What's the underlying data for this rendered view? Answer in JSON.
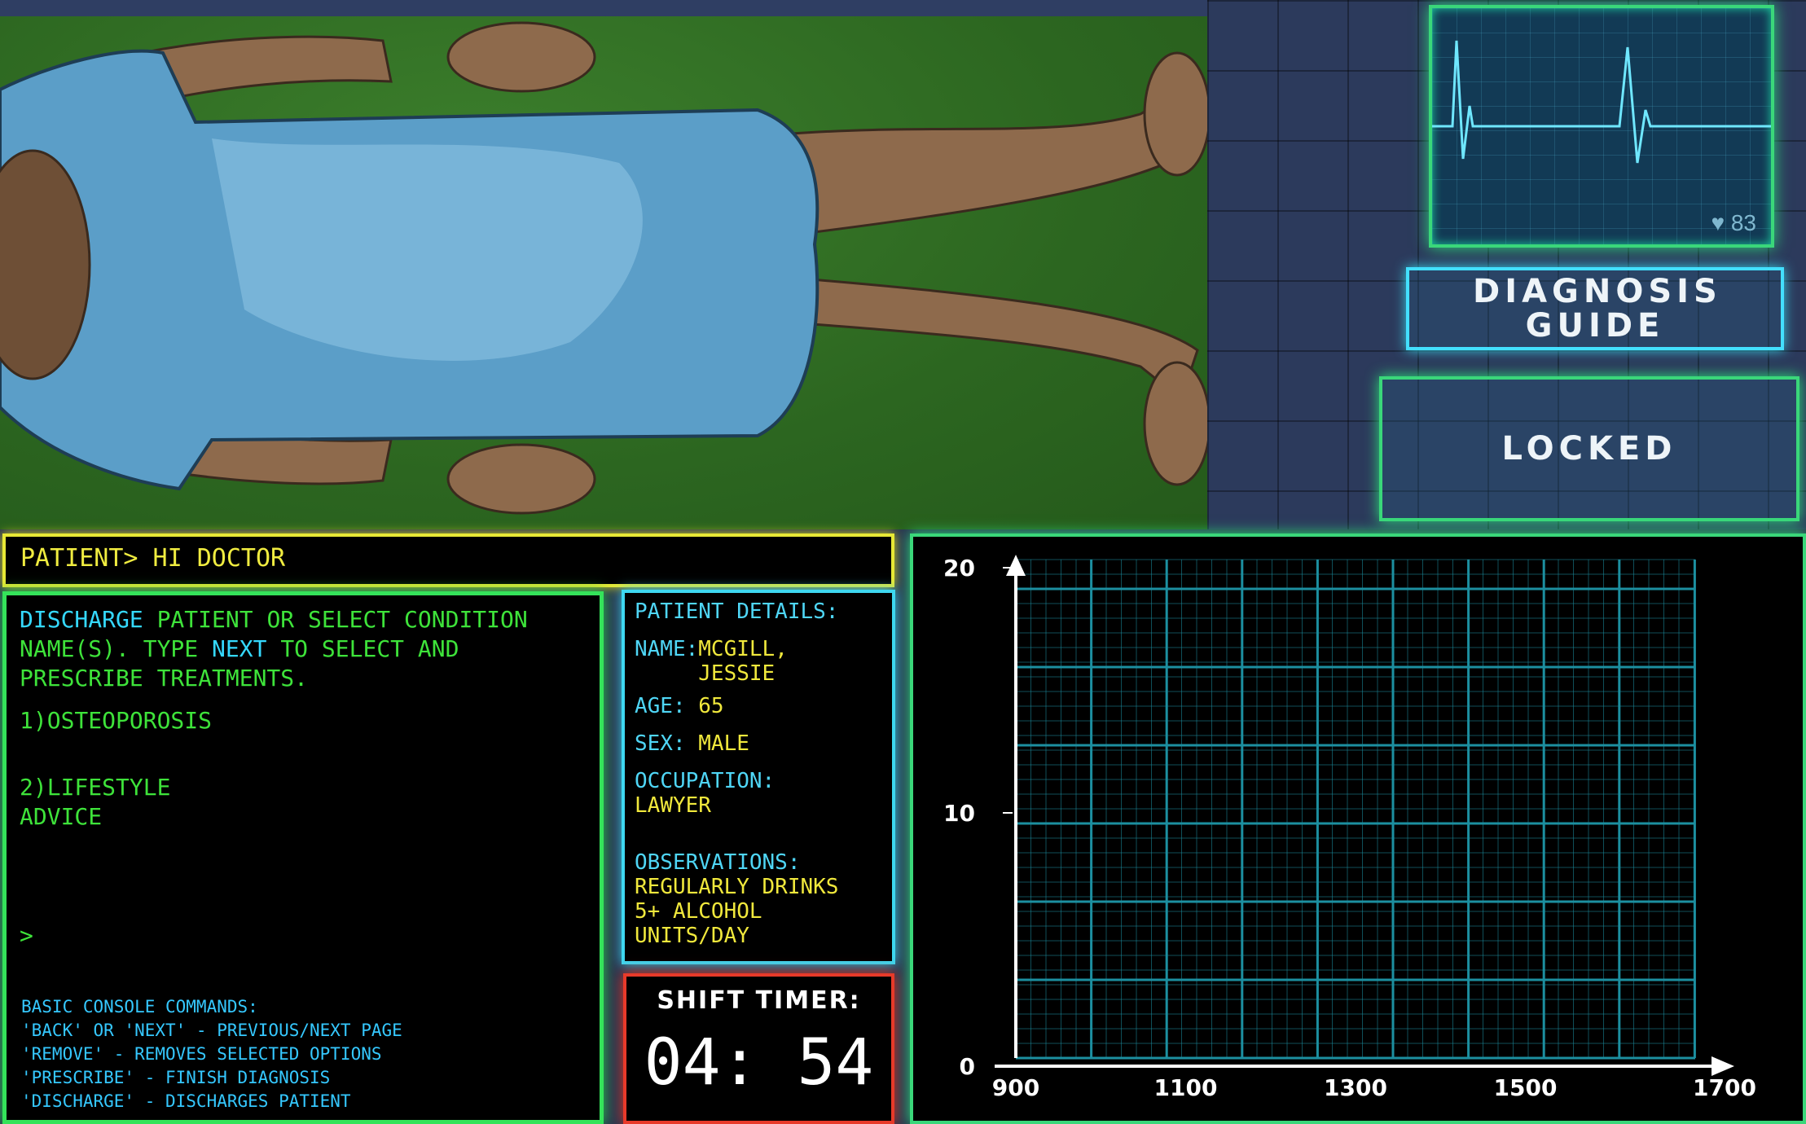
{
  "monitor": {
    "heart_rate": "83",
    "heart_icon": "heart-icon"
  },
  "buttons": {
    "diagnosis_guide": "DIAGNOSIS GUIDE",
    "locked": "LOCKED"
  },
  "dialogue": {
    "text": "PATIENT> HI DOCTOR"
  },
  "console": {
    "intro_1": "DISCHARGE",
    "intro_2": "PATIENT OR SELECT CONDITION NAME(S). TYPE",
    "intro_3": "NEXT",
    "intro_4": "TO SELECT AND PRESCRIBE TREATMENTS.",
    "options": [
      "1)OSTEOPOROSIS",
      "2)LIFESTYLE ADVICE"
    ],
    "prompt": ">",
    "commands_title": "BASIC CONSOLE COMMANDS:",
    "commands": [
      "'BACK' OR 'NEXT' - PREVIOUS/NEXT PAGE",
      "'REMOVE' - REMOVES SELECTED OPTIONS",
      "'PRESCRIBE' - FINISH DIAGNOSIS",
      "'DISCHARGE' - DISCHARGES PATIENT"
    ]
  },
  "details": {
    "title": "PATIENT DETAILS:",
    "name_label": "NAME:",
    "name_value": "MCGILL, JESSIE",
    "age_label": "AGE:",
    "age_value": "65",
    "sex_label": "SEX:",
    "sex_value": "MALE",
    "occupation_label": "OCCUPATION:",
    "occupation_value": "LAWYER",
    "observations_label": "OBSERVATIONS:",
    "observations_value": "REGULARLY DRINKS 5+ ALCOHOL UNITS/DAY"
  },
  "timer": {
    "label": "SHIFT TIMER:",
    "value": "04: 54"
  },
  "chart_data": {
    "type": "line",
    "x_ticks": [
      "900",
      "1100",
      "1300",
      "1500",
      "1700"
    ],
    "y_ticks": [
      "0",
      "10",
      "20"
    ],
    "xlim": [
      900,
      1700
    ],
    "ylim": [
      0,
      20
    ],
    "series": [],
    "grid": true,
    "colors": {
      "grid": "#1c8fa0",
      "axis": "#ffffff"
    }
  }
}
